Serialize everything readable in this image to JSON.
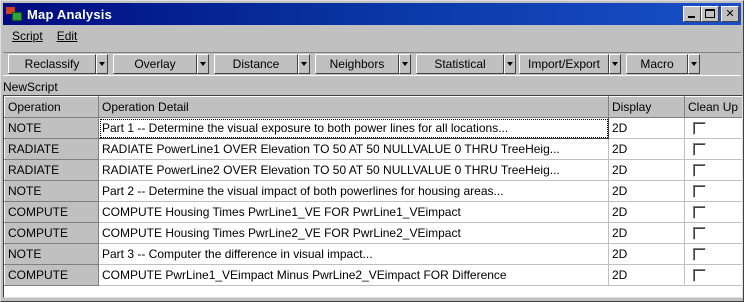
{
  "window": {
    "title": "Map Analysis",
    "icon": "map-analysis-app-icon",
    "buttons": [
      "minimize",
      "maximize",
      "close"
    ]
  },
  "menu": [
    {
      "label": "Script",
      "accel": "S"
    },
    {
      "label": "Edit",
      "accel": "E"
    }
  ],
  "toolbar": [
    {
      "label": "Reclassify"
    },
    {
      "label": "Overlay"
    },
    {
      "label": "Distance"
    },
    {
      "label": "Neighbors"
    },
    {
      "label": "Statistical"
    },
    {
      "label": "Import/Export"
    },
    {
      "label": "Macro"
    }
  ],
  "script_name": "NewScript",
  "grid": {
    "columns": [
      "Operation",
      "Operation Detail",
      "Display",
      "Clean Up"
    ],
    "rows": [
      {
        "operation": "NOTE",
        "detail": "Part 1 -- Determine the visual exposure to both power lines for all locations...",
        "display": "2D",
        "cleanup": false
      },
      {
        "operation": "RADIATE",
        "detail": "RADIATE PowerLine1 OVER Elevation TO 50 AT 50 NULLVALUE 0 THRU TreeHeig...",
        "display": "2D",
        "cleanup": false
      },
      {
        "operation": "RADIATE",
        "detail": "RADIATE PowerLine2 OVER Elevation TO 50 AT 50 NULLVALUE 0 THRU TreeHeig...",
        "display": "2D",
        "cleanup": false
      },
      {
        "operation": "NOTE",
        "detail": "Part 2 -- Determine the visual impact of both powerlines for housing areas...",
        "display": "2D",
        "cleanup": false
      },
      {
        "operation": "COMPUTE",
        "detail": "COMPUTE Housing Times PwrLine1_VE FOR PwrLine1_VEimpact",
        "display": "2D",
        "cleanup": false
      },
      {
        "operation": "COMPUTE",
        "detail": "COMPUTE Housing Times PwrLine2_VE FOR PwrLine2_VEimpact",
        "display": "2D",
        "cleanup": false
      },
      {
        "operation": "NOTE",
        "detail": "Part 3 -- Computer the difference in visual impact...",
        "display": "2D",
        "cleanup": false
      },
      {
        "operation": "COMPUTE",
        "detail": "COMPUTE PwrLine1_VEimpact Minus PwrLine2_VEimpact FOR Difference",
        "display": "2D",
        "cleanup": false
      }
    ]
  }
}
